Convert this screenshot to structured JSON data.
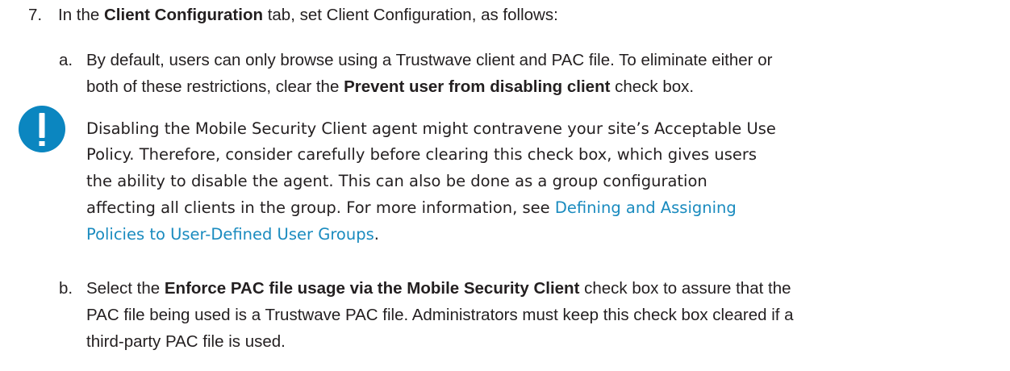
{
  "step7": {
    "number": "7.",
    "pre": "In the ",
    "bold": "Client Configuration",
    "post": " tab, set Client Configuration, as follows:"
  },
  "sub_a": {
    "letter": "a.",
    "line1": "By default, users can only browse using a Trustwave client and PAC file. To eliminate either or",
    "line2_pre": "both of these restrictions, clear the ",
    "line2_bold": "Prevent user from disabling client",
    "line2_post": " check box."
  },
  "note": {
    "icon": "exclamation-icon",
    "icon_color": "#0b86c0",
    "line1": "Disabling the Mobile Security Client agent might contravene your site’s Acceptable Use",
    "line2": "Policy. Therefore, consider carefully before clearing this check box, which gives users",
    "line3": "the ability to disable the agent. This can also be done as a group configuration",
    "line4_pre": "affecting all clients in the group. For more information, see ",
    "link_part1": "Defining and Assigning",
    "link_part2": "Policies to User-Defined User Groups",
    "line5_post": "."
  },
  "sub_b": {
    "letter": "b.",
    "line1_pre": "Select the ",
    "line1_bold": "Enforce PAC file usage via the Mobile Security Client",
    "line1_post": " check box to assure that the",
    "line2": "PAC file being used is a Trustwave PAC file. Administrators must keep this check box cleared if a",
    "line3": "third-party PAC file is used."
  }
}
